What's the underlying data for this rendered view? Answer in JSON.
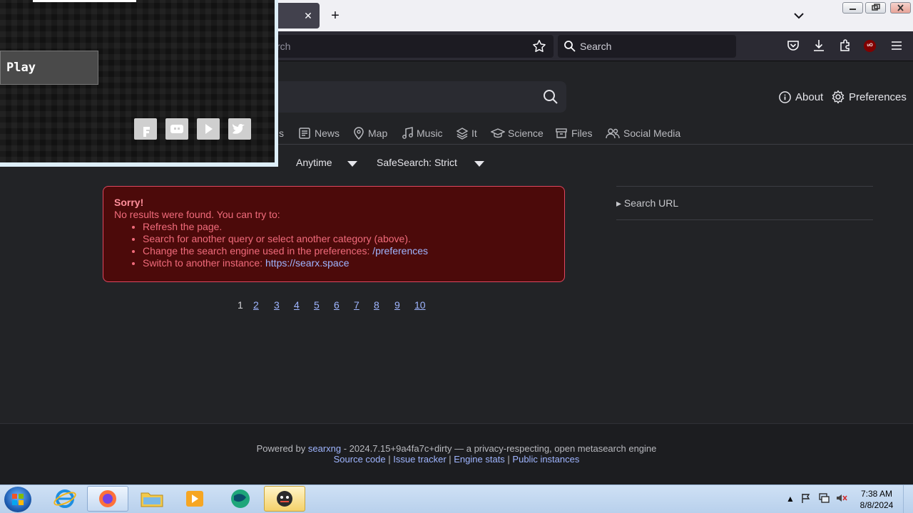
{
  "browser": {
    "url_placeholder": "rch",
    "search_placeholder": "Search",
    "tab_close": "✕",
    "new_tab": "+",
    "ublock_label": "uO"
  },
  "header": {
    "about": "About",
    "preferences": "Preferences"
  },
  "categories": [
    "s",
    "News",
    "Map",
    "Music",
    "It",
    "Science",
    "Files",
    "Social Media"
  ],
  "filters": {
    "time": "Anytime",
    "safesearch": "SafeSearch: Strict"
  },
  "alert": {
    "title": "Sorry!",
    "message": "No results were found. You can try to:",
    "tip1": "Refresh the page.",
    "tip2": "Search for another query or select another category (above).",
    "tip3_text": "Change the search engine used in the preferences: ",
    "tip3_link": "/preferences",
    "tip4_text": "Switch to another instance: ",
    "tip4_link": "https://searx.space"
  },
  "sidebar": {
    "search_url": "▸ Search URL"
  },
  "pagination": {
    "current": "1",
    "pages": [
      "2",
      "3",
      "4",
      "5",
      "6",
      "7",
      "8",
      "9",
      "10"
    ]
  },
  "footer": {
    "powered_by": "Powered by ",
    "searxng": "searxng",
    "version_text": " - 2024.7.15+9a4fa7c+dirty — a privacy-respecting, open metasearch engine",
    "source_code": "Source code",
    "issue_tracker": "Issue tracker",
    "engine_stats": "Engine stats",
    "public_instances": "Public instances",
    "sep": " | "
  },
  "popup": {
    "play": "Play"
  },
  "taskbar": {
    "time": "7:38 AM",
    "date": "8/8/2024",
    "tray_arrow": "▲"
  },
  "colors": {
    "page_bg": "#222326",
    "alert_bg": "#4c0a0a",
    "alert_border": "#e0475f",
    "link": "#9fb5ff"
  }
}
